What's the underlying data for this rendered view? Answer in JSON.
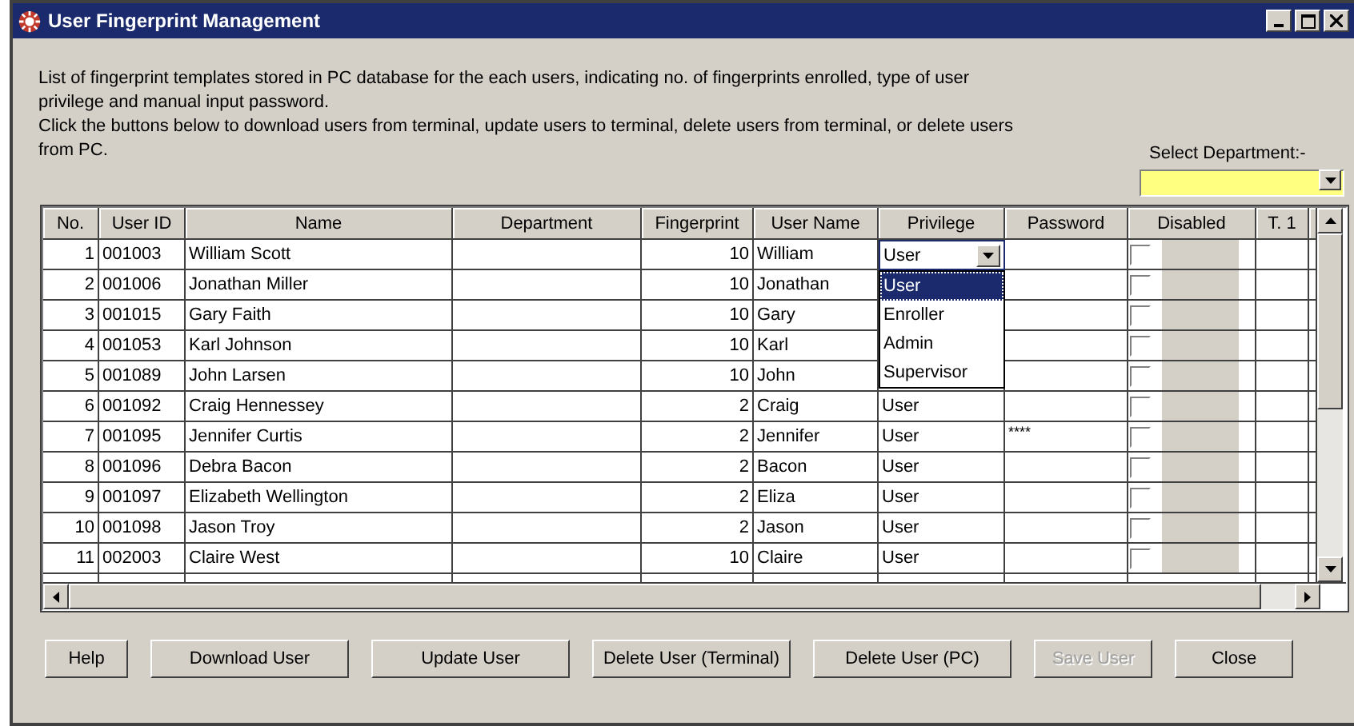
{
  "window": {
    "title": "User Fingerprint Management"
  },
  "description": [
    "List of fingerprint templates stored in PC database for the each users, indicating no. of fingerprints enrolled, type of user privilege and manual input password.",
    "Click the buttons below to download users from terminal, update users to terminal, delete users from terminal, or delete users from PC."
  ],
  "department_filter": {
    "label": "Select Department:-"
  },
  "table": {
    "columns": [
      "No.",
      "User ID",
      "Name",
      "Department",
      "Fingerprint",
      "User Name",
      "Privilege",
      "Password",
      "Disabled",
      "T. 1"
    ],
    "rows": [
      {
        "no": "1",
        "user_id": "001003",
        "name": "William Scott",
        "fingerprint": "10",
        "user_name": "William",
        "privilege": "User",
        "editing": true,
        "disabled": false
      },
      {
        "no": "2",
        "user_id": "001006",
        "name": "Jonathan Miller",
        "fingerprint": "10",
        "user_name": "Jonathan",
        "disabled": false
      },
      {
        "no": "3",
        "user_id": "001015",
        "name": "Gary Faith",
        "fingerprint": "10",
        "user_name": "Gary",
        "disabled": false
      },
      {
        "no": "4",
        "user_id": "001053",
        "name": "Karl Johnson",
        "fingerprint": "10",
        "user_name": "Karl",
        "disabled": false
      },
      {
        "no": "5",
        "user_id": "001089",
        "name": "John Larsen",
        "fingerprint": "10",
        "user_name": "John",
        "disabled": false
      },
      {
        "no": "6",
        "user_id": "001092",
        "name": "Craig Hennessey",
        "fingerprint": "2",
        "user_name": "Craig",
        "privilege": "User",
        "editing": false,
        "disabled": false
      },
      {
        "no": "7",
        "user_id": "001095",
        "name": "Jennifer Curtis",
        "fingerprint": "2",
        "user_name": "Jennifer",
        "privilege": "User",
        "password": "****",
        "editing": false,
        "disabled": false
      },
      {
        "no": "8",
        "user_id": "001096",
        "name": "Debra Bacon",
        "fingerprint": "2",
        "user_name": "Bacon",
        "privilege": "User",
        "editing": false,
        "disabled": false
      },
      {
        "no": "9",
        "user_id": "001097",
        "name": "Elizabeth Wellington",
        "fingerprint": "2",
        "user_name": "Eliza",
        "privilege": "User",
        "editing": false,
        "disabled": false
      },
      {
        "no": "10",
        "user_id": "001098",
        "name": "Jason Troy",
        "fingerprint": "2",
        "user_name": "Jason",
        "privilege": "User",
        "editing": false,
        "disabled": false
      },
      {
        "no": "11",
        "user_id": "002003",
        "name": "Claire West",
        "fingerprint": "10",
        "user_name": "Claire",
        "privilege": "User",
        "editing": false,
        "disabled": false
      }
    ]
  },
  "privilege_dropdown": [
    {
      "label": "User",
      "selected": true
    },
    {
      "label": "Enroller",
      "selected": false
    },
    {
      "label": "Admin",
      "selected": false
    },
    {
      "label": "Supervisor",
      "selected": false
    }
  ],
  "buttons": [
    {
      "label": "Help",
      "disabled": false
    },
    {
      "label": "Download User",
      "disabled": false
    },
    {
      "label": "Update User",
      "disabled": false
    },
    {
      "label": "Delete User (Terminal)",
      "disabled": false
    },
    {
      "label": "Delete User (PC)",
      "disabled": false
    },
    {
      "label": "Save User",
      "disabled": true
    },
    {
      "label": "Close",
      "disabled": false
    }
  ]
}
